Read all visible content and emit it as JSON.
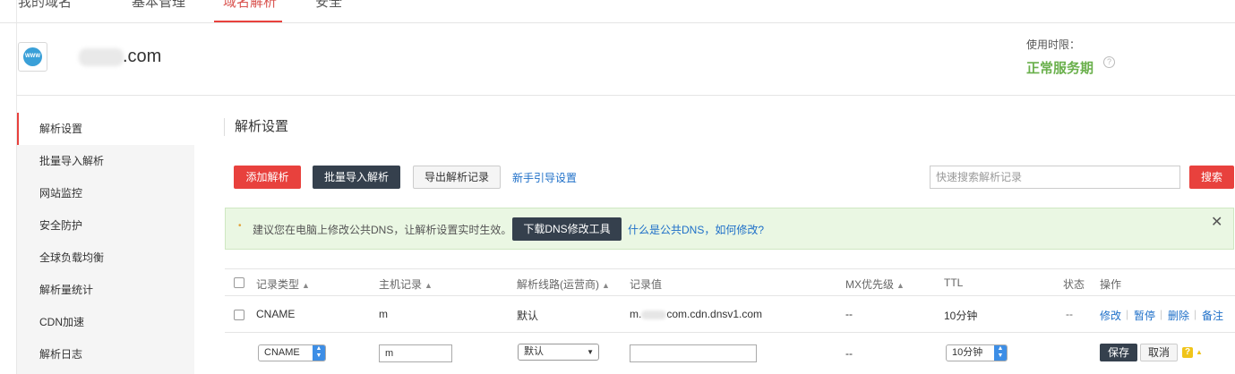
{
  "topnav": {
    "items": [
      "我的域名",
      "基本管理",
      "域名解析",
      "安全"
    ]
  },
  "domain": {
    "icon_text": "WWW",
    "suffix": ".com"
  },
  "service": {
    "label": "使用时限：",
    "status": "正常服务期",
    "help": "?"
  },
  "sidebar": {
    "items": [
      "解析设置",
      "批量导入解析",
      "网站监控",
      "安全防护",
      "全球负载均衡",
      "解析量统计",
      "CDN加速",
      "解析日志"
    ]
  },
  "section_title": "解析设置",
  "toolbar": {
    "add": "添加解析",
    "batch_import": "批量导入解析",
    "export": "导出解析记录",
    "guide": "新手引导设置",
    "search_placeholder": "快速搜索解析记录",
    "search_button": "搜索"
  },
  "notice": {
    "bullet": "•",
    "text": "建议您在电脑上修改公共DNS，让解析设置实时生效。",
    "download_button": "下载DNS修改工具",
    "link": "什么是公共DNS，如何修改?",
    "close": "✕"
  },
  "table": {
    "headers": {
      "type": "记录类型",
      "host": "主机记录",
      "line": "解析线路(运营商)",
      "value": "记录值",
      "mx": "MX优先级",
      "ttl": "TTL",
      "status": "状态",
      "ops": "操作"
    },
    "sort_glyph": "▲",
    "row": {
      "type": "CNAME",
      "host": "m",
      "line": "默认",
      "value_prefix": "m.",
      "value_suffix": "com.cdn.dnsv1.com",
      "mx": "--",
      "ttl": "10分钟",
      "status": "--",
      "ops": [
        "修改",
        "暂停",
        "删除",
        "备注"
      ]
    },
    "edit_row": {
      "type": "CNAME",
      "host": "m",
      "line": "默认",
      "value": "",
      "mx": "--",
      "ttl": "10分钟",
      "save": "保存",
      "cancel": "取消",
      "help": "?",
      "warn": "▲"
    }
  }
}
